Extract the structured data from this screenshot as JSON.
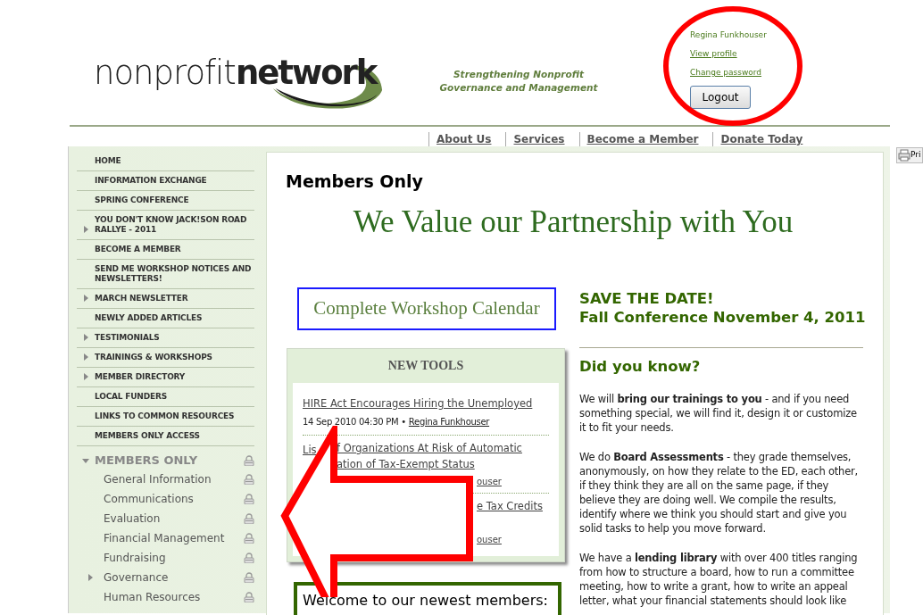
{
  "header": {
    "logo": {
      "light": "nonprofit",
      "bold": "network"
    },
    "tagline": [
      "Strengthening Nonprofit",
      "Governance and Management"
    ],
    "user": {
      "name": "Regina Funkhouser",
      "links": [
        "View profile",
        "Change password"
      ],
      "button": "Logout"
    }
  },
  "nav": [
    "About Us",
    "Services",
    "Become a Member",
    "Donate Today"
  ],
  "print_label": "Pri",
  "sidebar": {
    "items": [
      {
        "label": "HOME",
        "expandable": false
      },
      {
        "label": "INFORMATION EXCHANGE",
        "expandable": false
      },
      {
        "label": "SPRING CONFERENCE",
        "expandable": false
      },
      {
        "label": "YOU DON'T KNOW JACK!SON ROAD RALLYE - 2011",
        "expandable": true
      },
      {
        "label": "BECOME A MEMBER",
        "expandable": false
      },
      {
        "label": "SEND ME WORKSHOP NOTICES AND NEWSLETTERS!",
        "expandable": false
      },
      {
        "label": "MARCH NEWSLETTER",
        "expandable": true
      },
      {
        "label": "NEWLY ADDED ARTICLES",
        "expandable": false
      },
      {
        "label": "TESTIMONIALS",
        "expandable": true
      },
      {
        "label": "TRAININGS & WORKSHOPS",
        "expandable": true
      },
      {
        "label": "MEMBER DIRECTORY",
        "expandable": true
      },
      {
        "label": "LOCAL FUNDERS",
        "expandable": false
      },
      {
        "label": "LINKS TO COMMON RESOURCES",
        "expandable": false
      },
      {
        "label": "MEMBERS ONLY ACCESS",
        "expandable": false
      }
    ],
    "section": {
      "label": "MEMBERS ONLY",
      "expanded": true,
      "locked": true,
      "children": [
        {
          "label": "General Information",
          "expandable": false,
          "locked": true
        },
        {
          "label": "Communications",
          "expandable": false,
          "locked": true
        },
        {
          "label": "Evaluation",
          "expandable": false,
          "locked": true
        },
        {
          "label": "Financial Management",
          "expandable": false,
          "locked": true
        },
        {
          "label": "Fundraising",
          "expandable": false,
          "locked": true
        },
        {
          "label": "Governance",
          "expandable": true,
          "locked": true
        },
        {
          "label": "Human Resources",
          "expandable": false,
          "locked": true
        }
      ]
    }
  },
  "content": {
    "title": "Members Only",
    "banner": "We Value our Partnership with You",
    "calendar_link": "Complete Workshop Calendar",
    "new_tools": {
      "title": "NEW TOOLS",
      "items": [
        {
          "kind": "full",
          "title": "HIRE Act Encourages Hiring the Unemployed",
          "date": "14 Sep 2010 04:30 PM",
          "separator": "•",
          "author": "Regina Funkhouser"
        },
        {
          "kind": "covered",
          "lines": [
            {
              "kind": "title",
              "left": "Lis",
              "right": "f Organizations At Risk of Automatic"
            },
            {
              "kind": "title",
              "right": "ation of Tax-Exempt Status"
            },
            {
              "kind": "author",
              "right": "ouser"
            }
          ]
        },
        {
          "kind": "covered",
          "lines": [
            {
              "kind": "title",
              "right": "e Tax Credits"
            },
            {
              "kind": "author",
              "right": "ouser"
            }
          ]
        }
      ]
    },
    "welcome": "Welcome to our newest members:",
    "save_the_date": [
      "SAVE THE DATE!",
      "Fall Conference November 4, 2011"
    ],
    "did_you_know": "Did you know?",
    "paragraphs": [
      "We will **bring our trainings to you** - and if you need something special, we will find it, design it or customize it to fit your needs.",
      "We do **Board Assessments** - they grade themselves, anonymously, on how they relate to the ED, each other, if they think they are all on the same page, if they believe they are doing well.  We compile the results, identify where we think you should start and give you solid tasks to help you move forward.",
      "We have a **lending library** with over 400 titles ranging from how to structure a board, how to run a committee meeting, how to write a grant, how to write an appeal letter, what your financial statements should look like"
    ]
  }
}
